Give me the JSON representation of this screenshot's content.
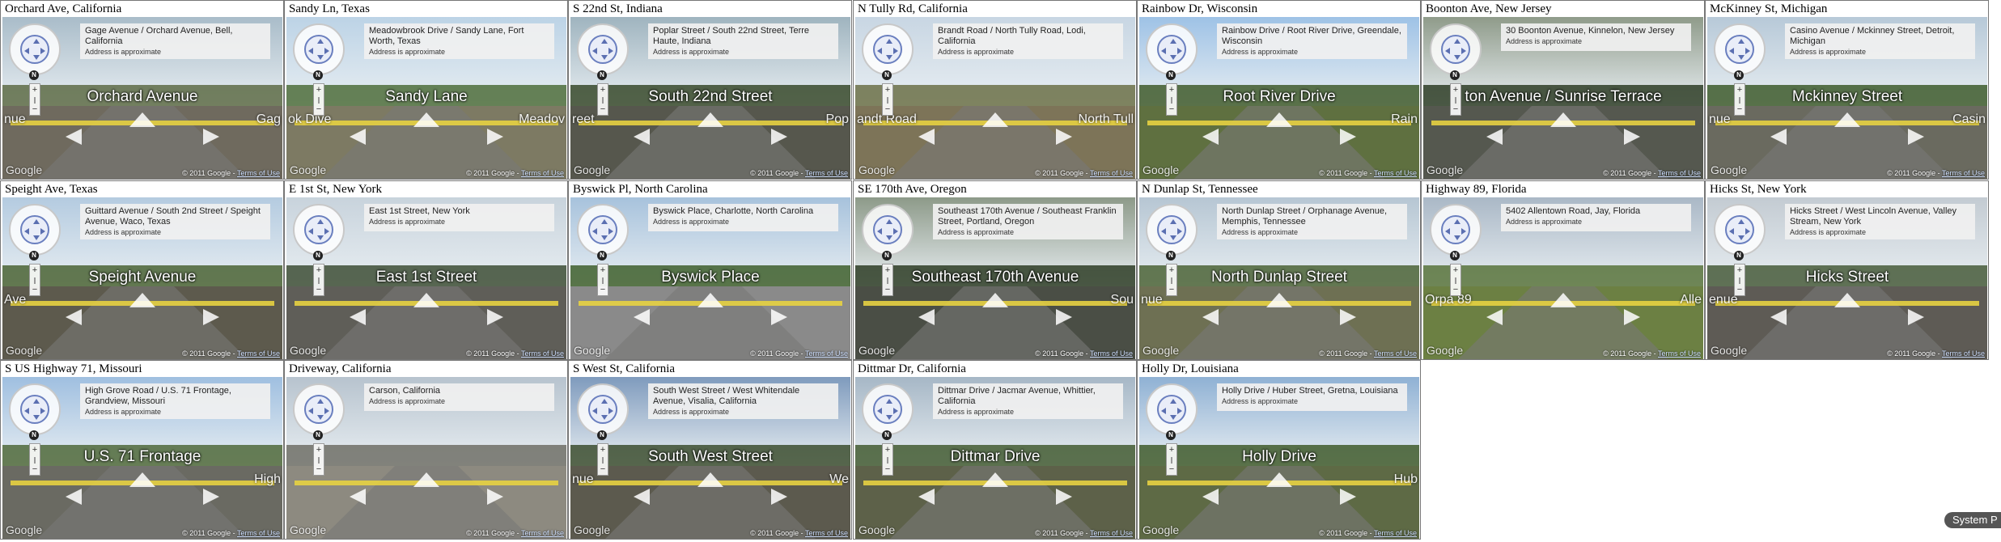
{
  "common": {
    "address_note": "Address is approximate",
    "google_logo": "Google",
    "copyright": "© 2011 Google -",
    "terms": "Terms of Use",
    "compass_letter": "N",
    "zoom_plus": "+",
    "zoom_minus": "−"
  },
  "system_pill": "System P",
  "cells": [
    {
      "title": "Orchard Ave, California",
      "address": "Gage Avenue / Orchard Avenue, Bell, California",
      "street": "Orchard Avenue",
      "side": "Gag",
      "side_left": "nue",
      "sky": "#a9bcc9",
      "ground": "#6f6a5e",
      "trees": "#5d6b45"
    },
    {
      "title": "Sandy Ln, Texas",
      "address": "Meadowbrook Drive / Sandy Lane, Fort Worth, Texas",
      "street": "Sandy Lane",
      "side": "Meadov",
      "side_left": "ok Dive",
      "sky": "#bcd3e6",
      "ground": "#7d7a63",
      "trees": "#4e6d3b"
    },
    {
      "title": "S 22nd St, Indiana",
      "address": "Poplar Street / South 22nd Street, Terre Haute, Indiana",
      "street": "South 22nd Street",
      "side": "Pop",
      "side_left": "reet",
      "sky": "#9fb4bf",
      "ground": "#56574d",
      "trees": "#37492a"
    },
    {
      "title": "N Tully Rd, California",
      "address": "Brandt Road / North Tully Road, Lodi, California",
      "street": "",
      "side": "North Tull",
      "side_left": "andt Road",
      "sky": "#c8d6e3",
      "ground": "#7d7458",
      "trees": "#6b7047"
    },
    {
      "title": "Rainbow Dr, Wisconsin",
      "address": "Rainbow Drive / Root River Drive, Greendale, Wisconsin",
      "street": "Root River Drive",
      "side": "Rain",
      "side_left": "",
      "sky": "#9ec2e6",
      "ground": "#5f7040",
      "trees": "#3f5a2c"
    },
    {
      "title": "Boonton Ave, New Jersey",
      "address": "30 Boonton Avenue, Kinnelon, New Jersey",
      "street": "ton Avenue / Sunrise Terrace",
      "side": "",
      "side_left": "",
      "sky": "#8f9b8a",
      "ground": "#55584f",
      "trees": "#2e3d26"
    },
    {
      "title": "McKinney St, Michigan",
      "address": "Casino Avenue / Mckinney Street, Detroit, Michigan",
      "street": "Mckinney Street",
      "side": "Casin",
      "side_left": "nue",
      "sky": "#b7c9d8",
      "ground": "#6a6a5f",
      "trees": "#3d5a2b"
    },
    {
      "title": "Speight Ave, Texas",
      "address": "Guittard Avenue / South 2nd Street / Speight Avenue, Waco, Texas",
      "street": "Speight Avenue",
      "side": "",
      "side_left": "Ave",
      "sky": "#b4cbe0",
      "ground": "#5d5a4d",
      "trees": "#4a6334"
    },
    {
      "title": "E 1st St, New York",
      "address": "East 1st Street, New York",
      "street": "East 1st Street",
      "side": "",
      "side_left": "",
      "sky": "#c8d3dc",
      "ground": "#5f5e58",
      "trees": "#3d4d35"
    },
    {
      "title": "Byswick Pl, North Carolina",
      "address": "Byswick Place, Charlotte, North Carolina",
      "street": "Byswick Place",
      "side": "",
      "side_left": "",
      "sky": "#a7c2dc",
      "ground": "#8a8a8a",
      "trees": "#3e5f2c"
    },
    {
      "title": "SE 170th Ave, Oregon",
      "address": "Southeast 170th Avenue / Southeast Franklin Street, Portland, Oregon",
      "street": "Southeast 170th Avenue",
      "side": "Sou",
      "side_left": "",
      "sky": "#8d9a89",
      "ground": "#4a4e45",
      "trees": "#2d3c25"
    },
    {
      "title": "N Dunlap St, Tennessee",
      "address": "North Dunlap Street / Orphanage Avenue, Memphis, Tennessee",
      "street": "North Dunlap Street",
      "side": "",
      "side_left": "nue",
      "sky": "#b6c6d3",
      "ground": "#6e7053",
      "trees": "#4b6336"
    },
    {
      "title": "Highway 89, Florida",
      "address": "5402 Allentown Road, Jay, Florida",
      "street": "",
      "side": "Alle",
      "side_left": "Orpa 89",
      "sky": "#aab8c6",
      "ground": "#6c8043",
      "trees": "#58733b"
    },
    {
      "title": "Hicks St, New York",
      "address": "Hicks Street / West Lincoln Avenue, Valley Stream, New York",
      "street": "Hicks Street",
      "side": "",
      "side_left": "enue",
      "sky": "#c3cbd2",
      "ground": "#5e5b55",
      "trees": "#465a3a"
    },
    {
      "title": "S US Highway 71, Missouri",
      "address": "High Grove Road / U.S. 71 Frontage, Grandview, Missouri",
      "street": "U.S. 71 Frontage",
      "side": "High",
      "side_left": "",
      "sky": "#9fbfe0",
      "ground": "#6a6a62",
      "trees": "#4f6939"
    },
    {
      "title": "Driveway, California",
      "address": "Carson, California",
      "street": "",
      "side": "",
      "side_left": "",
      "sky": "#b7c3ce",
      "ground": "#8d8a80",
      "trees": "#6e6f66"
    },
    {
      "title": "S West St, California",
      "address": "South West Street / West Whitendale Avenue, Visalia, California",
      "street": "South West Street",
      "side": "We",
      "side_left": "nue",
      "sky": "#7f9bbd",
      "ground": "#5c5a4e",
      "trees": "#3c4e2f"
    },
    {
      "title": "Dittmar Dr, California",
      "address": "Dittmar Drive / Jacmar Avenue, Whittier, California",
      "street": "Dittmar Drive",
      "side": "",
      "side_left": "",
      "sky": "#a6b7c6",
      "ground": "#5d6149",
      "trees": "#425a31"
    },
    {
      "title": "Holly Dr, Louisiana",
      "address": "Holly Drive / Huber Street, Gretna, Louisiana",
      "street": "Holly Drive",
      "side": "Hub",
      "side_left": "",
      "sky": "#8fb1d4",
      "ground": "#5e6a45",
      "trees": "#3f5b2c"
    }
  ]
}
